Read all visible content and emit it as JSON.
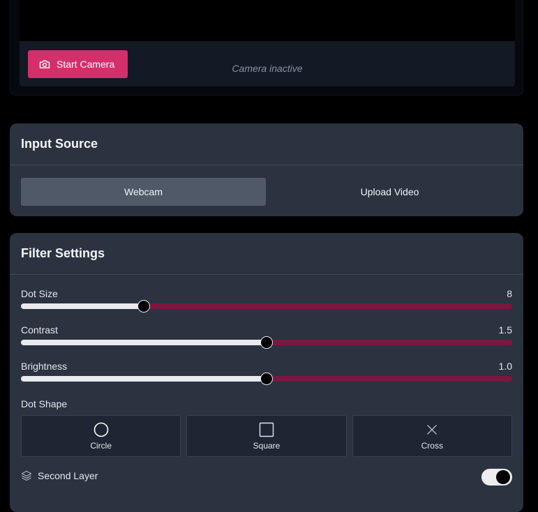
{
  "camera": {
    "start_label": "Start Camera",
    "status": "Camera inactive",
    "icon": "camera-icon"
  },
  "input_source": {
    "title": "Input Source",
    "tabs": [
      {
        "label": "Webcam",
        "active": true
      },
      {
        "label": "Upload Video",
        "active": false
      }
    ]
  },
  "filter_settings": {
    "title": "Filter Settings",
    "sliders": [
      {
        "label": "Dot Size",
        "value": "8",
        "fraction": 0.25
      },
      {
        "label": "Contrast",
        "value": "1.5",
        "fraction": 0.5
      },
      {
        "label": "Brightness",
        "value": "1.0",
        "fraction": 0.5
      }
    ],
    "shape_label": "Dot Shape",
    "shapes": [
      {
        "label": "Circle",
        "icon": "circle-icon"
      },
      {
        "label": "Square",
        "icon": "square-icon"
      },
      {
        "label": "Cross",
        "icon": "cross-icon"
      }
    ],
    "second_layer": {
      "label": "Second Layer",
      "icon": "layers-icon",
      "enabled": true
    }
  },
  "colors": {
    "accent": "#d52f6b",
    "track": "#7c1740",
    "card": "#2b3341"
  }
}
